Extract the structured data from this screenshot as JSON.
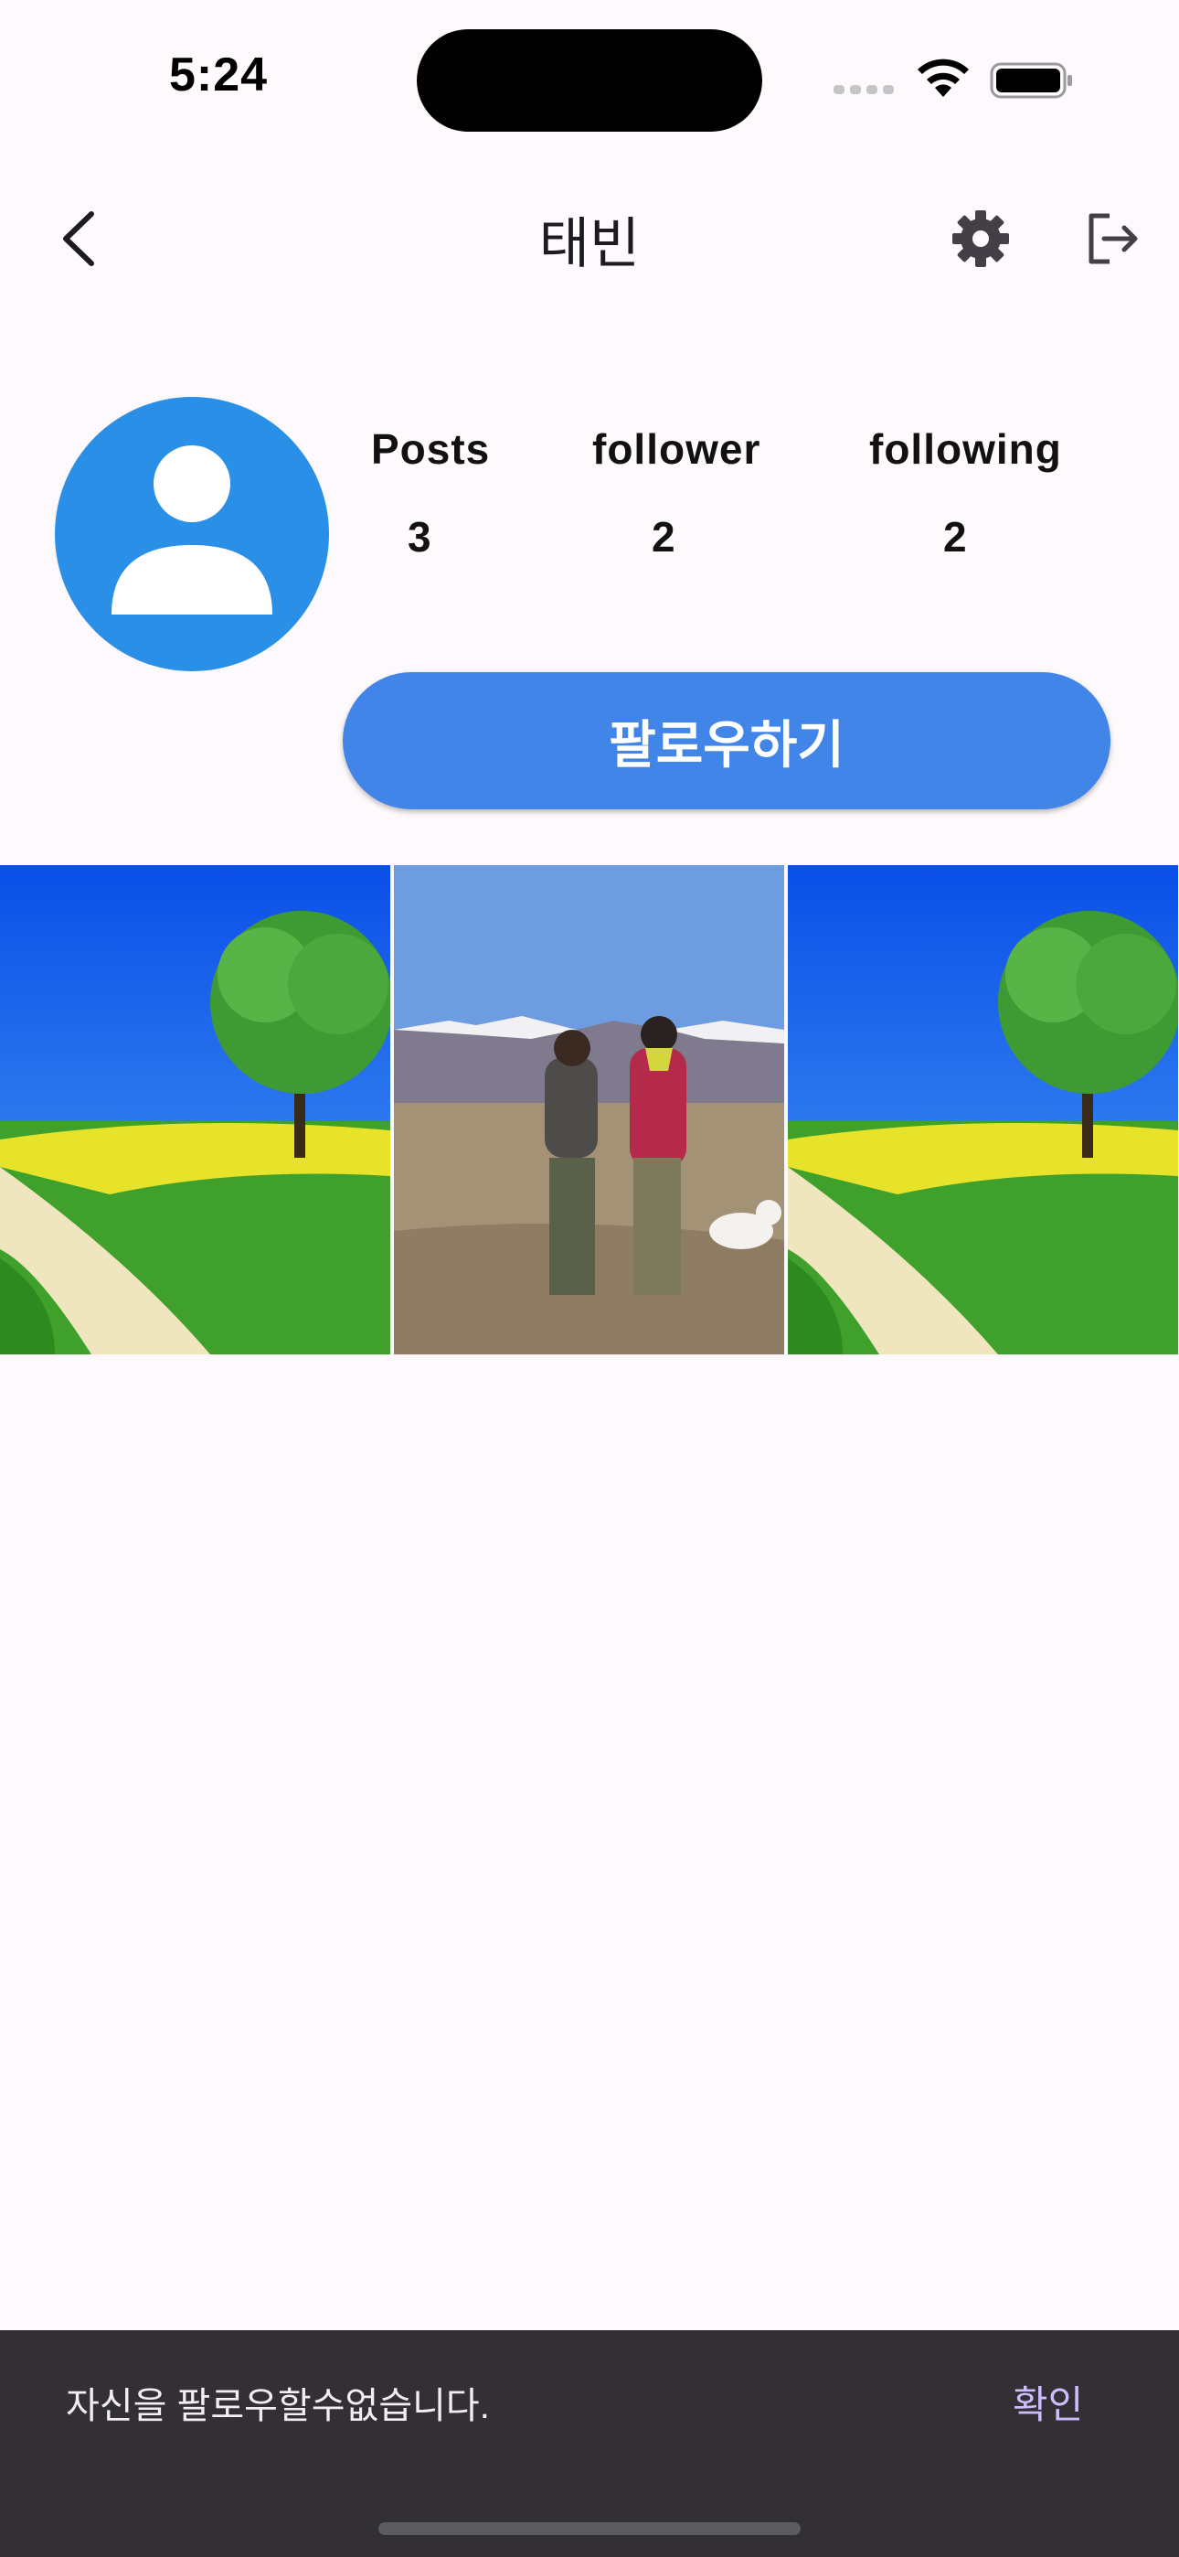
{
  "status_bar": {
    "time": "5:24"
  },
  "header": {
    "title": "태빈"
  },
  "profile": {
    "stats": [
      {
        "label": "Posts",
        "value": "3"
      },
      {
        "label": "follower",
        "value": "2"
      },
      {
        "label": "following",
        "value": "2"
      }
    ],
    "follow_button_label": "팔로우하기"
  },
  "snackbar": {
    "message": "자신을 팔로우할수없습니다.",
    "action_label": "확인"
  },
  "colors": {
    "accent": "#4285e8",
    "avatar": "#2a8fe6",
    "snackbar_bg": "#323035",
    "snackbar_action": "#cfbcff",
    "background": "#fdf9fc"
  }
}
